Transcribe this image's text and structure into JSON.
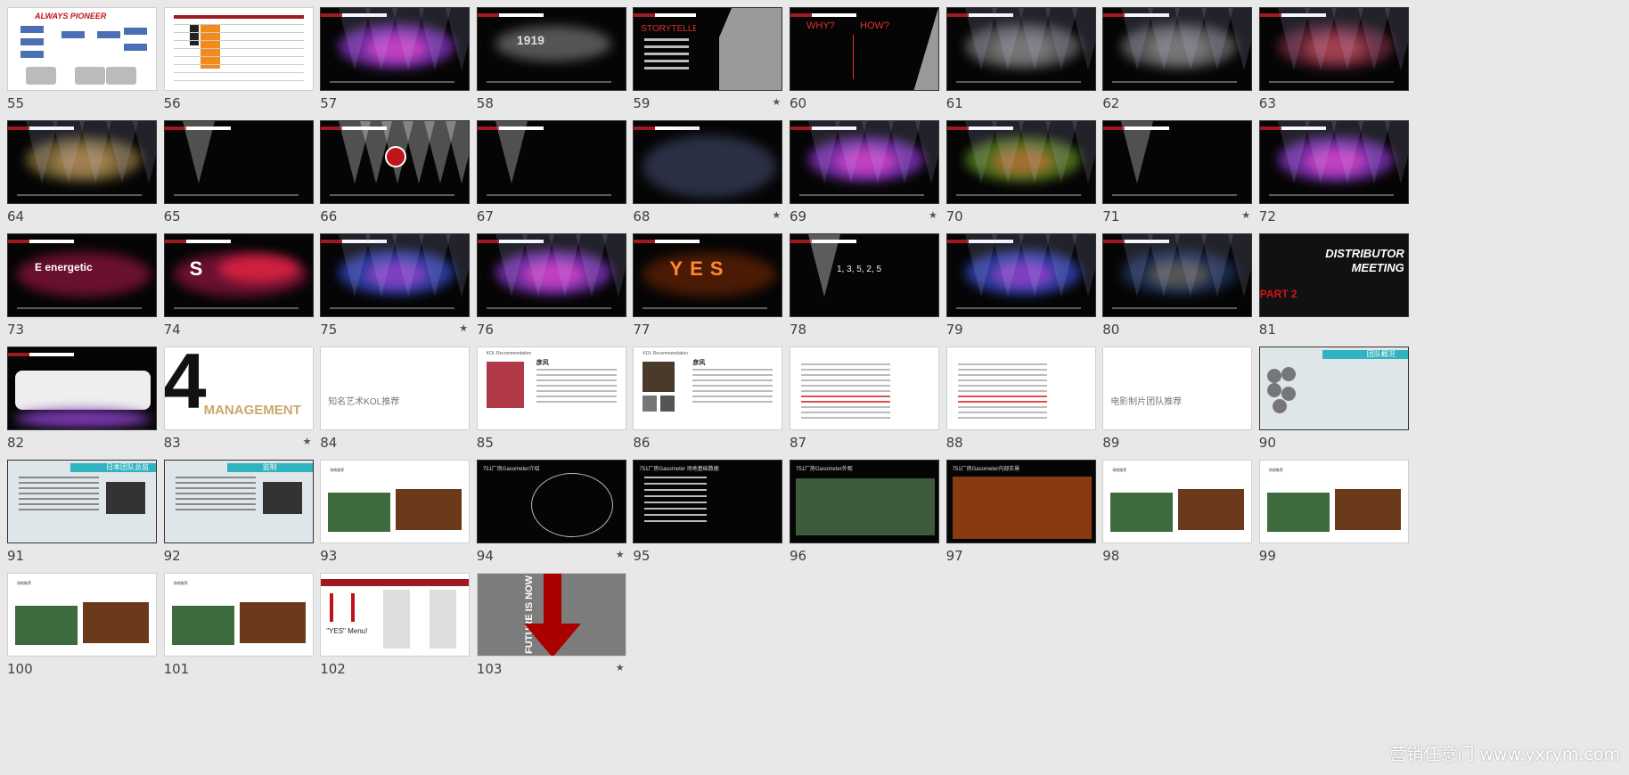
{
  "watermark": "营销任意门 www.yxrym.com",
  "slides": [
    {
      "n": "55",
      "star": false,
      "kind": "diagram",
      "title": "ALWAYS PIONEER"
    },
    {
      "n": "56",
      "star": false,
      "kind": "table"
    },
    {
      "n": "57",
      "star": false,
      "kind": "stage-purple"
    },
    {
      "n": "58",
      "star": false,
      "kind": "stage-grey",
      "label": "1919"
    },
    {
      "n": "59",
      "star": true,
      "kind": "storyteller",
      "label": "STORYTELLER"
    },
    {
      "n": "60",
      "star": false,
      "kind": "whyhow",
      "label": "WHY?",
      "label2": "HOW?"
    },
    {
      "n": "61",
      "star": false,
      "kind": "stage-grey"
    },
    {
      "n": "62",
      "star": false,
      "kind": "stage-grey"
    },
    {
      "n": "63",
      "star": false,
      "kind": "stage-red"
    },
    {
      "n": "64",
      "star": false,
      "kind": "stage-warm"
    },
    {
      "n": "65",
      "star": false,
      "kind": "spot"
    },
    {
      "n": "66",
      "star": false,
      "kind": "spot-logo"
    },
    {
      "n": "67",
      "star": false,
      "kind": "spot"
    },
    {
      "n": "68",
      "star": true,
      "kind": "nebula"
    },
    {
      "n": "69",
      "star": true,
      "kind": "stage-purple"
    },
    {
      "n": "70",
      "star": false,
      "kind": "stage-green"
    },
    {
      "n": "71",
      "star": true,
      "kind": "spot"
    },
    {
      "n": "72",
      "star": false,
      "kind": "stage-purple"
    },
    {
      "n": "73",
      "star": false,
      "kind": "energetic",
      "label": "E energetic"
    },
    {
      "n": "74",
      "star": false,
      "kind": "sexy",
      "label": "S"
    },
    {
      "n": "75",
      "star": true,
      "kind": "stage-blue"
    },
    {
      "n": "76",
      "star": false,
      "kind": "stage-purple"
    },
    {
      "n": "77",
      "star": false,
      "kind": "yes",
      "label": "YES"
    },
    {
      "n": "78",
      "star": false,
      "kind": "count",
      "label": "1, 3, 5, 2, 5"
    },
    {
      "n": "79",
      "star": false,
      "kind": "stage-blue"
    },
    {
      "n": "80",
      "star": false,
      "kind": "stage-dark"
    },
    {
      "n": "81",
      "star": false,
      "kind": "distributor",
      "label": "DISTRIBUTOR MEETING",
      "label2": "PART 2"
    },
    {
      "n": "82",
      "star": false,
      "kind": "screen"
    },
    {
      "n": "83",
      "star": true,
      "kind": "management",
      "label": "4",
      "label2": "MANAGEMENT"
    },
    {
      "n": "84",
      "star": false,
      "kind": "blank-text",
      "label": "知名艺术KOL推荐"
    },
    {
      "n": "85",
      "star": false,
      "kind": "profile",
      "label": "彦风"
    },
    {
      "n": "86",
      "star": false,
      "kind": "profile2",
      "label": "彦风"
    },
    {
      "n": "87",
      "star": false,
      "kind": "text"
    },
    {
      "n": "88",
      "star": false,
      "kind": "text"
    },
    {
      "n": "89",
      "star": false,
      "kind": "blank-text",
      "label": "电影制片团队推荐"
    },
    {
      "n": "90",
      "star": false,
      "kind": "team",
      "label": "团队概况"
    },
    {
      "n": "91",
      "star": false,
      "kind": "person",
      "label": "日本团队总监"
    },
    {
      "n": "92",
      "star": false,
      "kind": "person",
      "label": "监制"
    },
    {
      "n": "93",
      "star": false,
      "kind": "venue"
    },
    {
      "n": "94",
      "star": true,
      "kind": "venue-dark",
      "label": "751厂房Gasometer介绍"
    },
    {
      "n": "95",
      "star": false,
      "kind": "venue-lines",
      "label": "751厂房Gasometer 场地基础数据"
    },
    {
      "n": "96",
      "star": false,
      "kind": "venue-ext",
      "label": "751厂房Gasometer外观"
    },
    {
      "n": "97",
      "star": false,
      "kind": "venue-int",
      "label": "751厂房Gasometer内部实景"
    },
    {
      "n": "98",
      "star": false,
      "kind": "venue"
    },
    {
      "n": "99",
      "star": false,
      "kind": "venue"
    },
    {
      "n": "100",
      "star": false,
      "kind": "venue"
    },
    {
      "n": "101",
      "star": false,
      "kind": "venue"
    },
    {
      "n": "102",
      "star": false,
      "kind": "menu",
      "label": "\"YES\" Menu!"
    },
    {
      "n": "103",
      "star": true,
      "kind": "future",
      "label": "FUTURE IS NOW"
    }
  ]
}
